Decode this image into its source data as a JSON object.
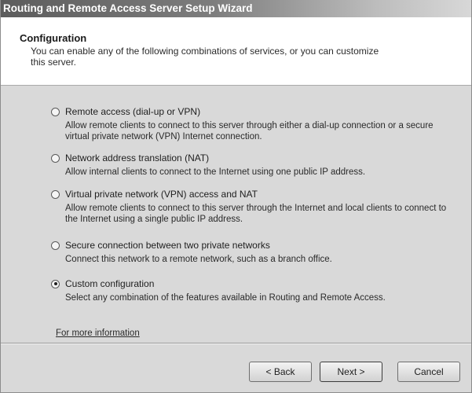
{
  "window": {
    "title": "Routing and Remote Access Server Setup Wizard"
  },
  "header": {
    "title": "Configuration",
    "description": "You can enable any of the following combinations of services, or you can customize this server."
  },
  "options": [
    {
      "label": "Remote access (dial-up or VPN)",
      "description": "Allow remote clients to connect to this server through either a dial-up connection or a secure virtual private network (VPN) Internet connection.",
      "selected": false
    },
    {
      "label": "Network address translation (NAT)",
      "description": "Allow internal clients to connect to the Internet using one public IP address.",
      "selected": false
    },
    {
      "label": "Virtual private network (VPN) access and NAT",
      "description": "Allow remote clients to connect to this server through the Internet and local clients to connect to the Internet using a single public IP address.",
      "selected": false
    },
    {
      "label": "Secure connection between two private networks",
      "description": "Connect this network to a remote network, such as a branch office.",
      "selected": false
    },
    {
      "label": "Custom configuration",
      "description": "Select any combination of the features available in Routing and Remote Access.",
      "selected": true
    }
  ],
  "more_info_link": "For more information",
  "buttons": {
    "back": "< Back",
    "next": "Next >",
    "cancel": "Cancel"
  }
}
